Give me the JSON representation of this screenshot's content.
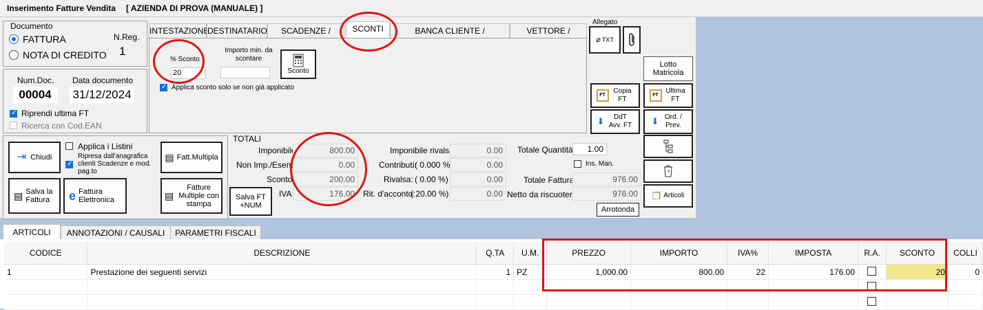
{
  "window": {
    "title": "Inserimento Fatture Vendita",
    "company": "[ AZIENDA DI PROVA (MANUALE) ]"
  },
  "documento": {
    "group_label": "Documento",
    "options": [
      "FATTURA",
      "NOTA DI CREDITO"
    ],
    "selected": "FATTURA",
    "nreg_label": "N.Reg.",
    "nreg_value": "1",
    "numdoc_label": "Num.Doc.",
    "numdoc_value": "00004",
    "data_label": "Data documento",
    "data_value": "31/12/2024",
    "riprendi_label": "Riprendi ultima FT",
    "riprendi_checked": true,
    "ricerca_label": "Ricerca con Cod.EAN",
    "ricerca_checked": false
  },
  "tabs": [
    "INTESTAZIONE",
    "DESTINATARIO",
    "SCADENZE / PAG.TO",
    "SCONTI",
    "BANCA CLIENTE  / DIC.INTENTO",
    "VETTORE / AGENTI"
  ],
  "active_tab": "SCONTI",
  "sconti": {
    "perc_label": "% Sconto",
    "perc_value": "20",
    "importo_label": "Importo min. da scontare",
    "importo_value": "",
    "sconto_button": "Sconto",
    "applica_label": "Applica sconto solo se non già applicato",
    "applica_checked": true
  },
  "allegato": {
    "label": "Allegato",
    "txt_button": "TXT"
  },
  "right_buttons": {
    "lotto": "Lotto Matricola",
    "copia": "Copia FT",
    "ultima": "Ultima FT",
    "ddt": "DdT Avv. FT",
    "ord": "Ord. / Prev.",
    "articoli": "Articoli"
  },
  "left_buttons": {
    "chiudi": "Chiudi",
    "salva": "Salva la Fattura",
    "elettronica": "Fattura Elettronica",
    "multipla": "Fatt.Multipla",
    "multiple_stampa": "Fatture Multiple con stampa",
    "salva_num": "Salva FT +NUM",
    "listini_label": "Applica i Listini",
    "listini_checked": false,
    "ripresa_label": "Ripresa dall'anagrafica clienti Scadenze e mod. pag.to",
    "ripresa_checked": true
  },
  "totali": {
    "title": "TOTALI",
    "imponibile_label": "Imponibile:",
    "imponibile": "800.00",
    "nonimp_label": "Non Imp./Esenti:",
    "nonimp": "0.00",
    "sconto_label": "Sconto:",
    "sconto": "200.00",
    "iva_label": "IVA:",
    "iva": "176.00",
    "imp_rivalsa_label": "Imponibile rivalsa:",
    "imp_rivalsa": "0.00",
    "contributi_label": "Contributi:",
    "contributi_perc": "( 0.000 %)",
    "contributi": "0.00",
    "rivalsa_label": "Rivalsa:",
    "rivalsa_perc": "( 0.00 %)",
    "rivalsa": "0.00",
    "ritenuta_label": "Rit. d'acconto:",
    "ritenuta_perc": "( 20.00 %)",
    "ritenuta": "0.00",
    "quantita_label": "Totale Quantità:",
    "quantita": "1.00",
    "insman_label": "Ins. Man.",
    "insman_checked": false,
    "totale_label": "Totale Fattura:",
    "totale": "976.00",
    "netto_label": "Netto da riscuotere:",
    "netto": "976.00",
    "arrotonda": "Arrotonda"
  },
  "bottom_tabs": [
    "ARTICOLI",
    "ANNOTAZIONI  / CAUSALI",
    "PARAMETRI FISCALI"
  ],
  "bottom_active": "ARTICOLI",
  "grid": {
    "columns": [
      "CODICE",
      "DESCRIZIONE",
      "Q.TA",
      "U.M.",
      "PREZZO",
      "IMPORTO",
      "IVA%",
      "IMPOSTA",
      "R.A.",
      "SCONTO",
      "COLLI"
    ],
    "rows": [
      {
        "codice": "1",
        "descrizione": "Prestazione dei seguenti servizi",
        "qta": "1",
        "um": "PZ",
        "prezzo": "1,000.00",
        "importo": "800.00",
        "iva": "22",
        "imposta": "176.00",
        "ra": false,
        "sconto": "20",
        "colli": "0"
      },
      {
        "codice": "",
        "descrizione": "",
        "qta": "",
        "um": "",
        "prezzo": "",
        "importo": "",
        "iva": "",
        "imposta": "",
        "ra": false,
        "sconto": "",
        "colli": ""
      },
      {
        "codice": "",
        "descrizione": "",
        "qta": "",
        "um": "",
        "prezzo": "",
        "importo": "",
        "iva": "",
        "imposta": "",
        "ra": false,
        "sconto": "",
        "colli": ""
      }
    ]
  },
  "colors": {
    "background": "#b0c4de",
    "highlight": "#f0e68c",
    "annotation": "#e01414",
    "checkbox": "#1a6fd6"
  }
}
